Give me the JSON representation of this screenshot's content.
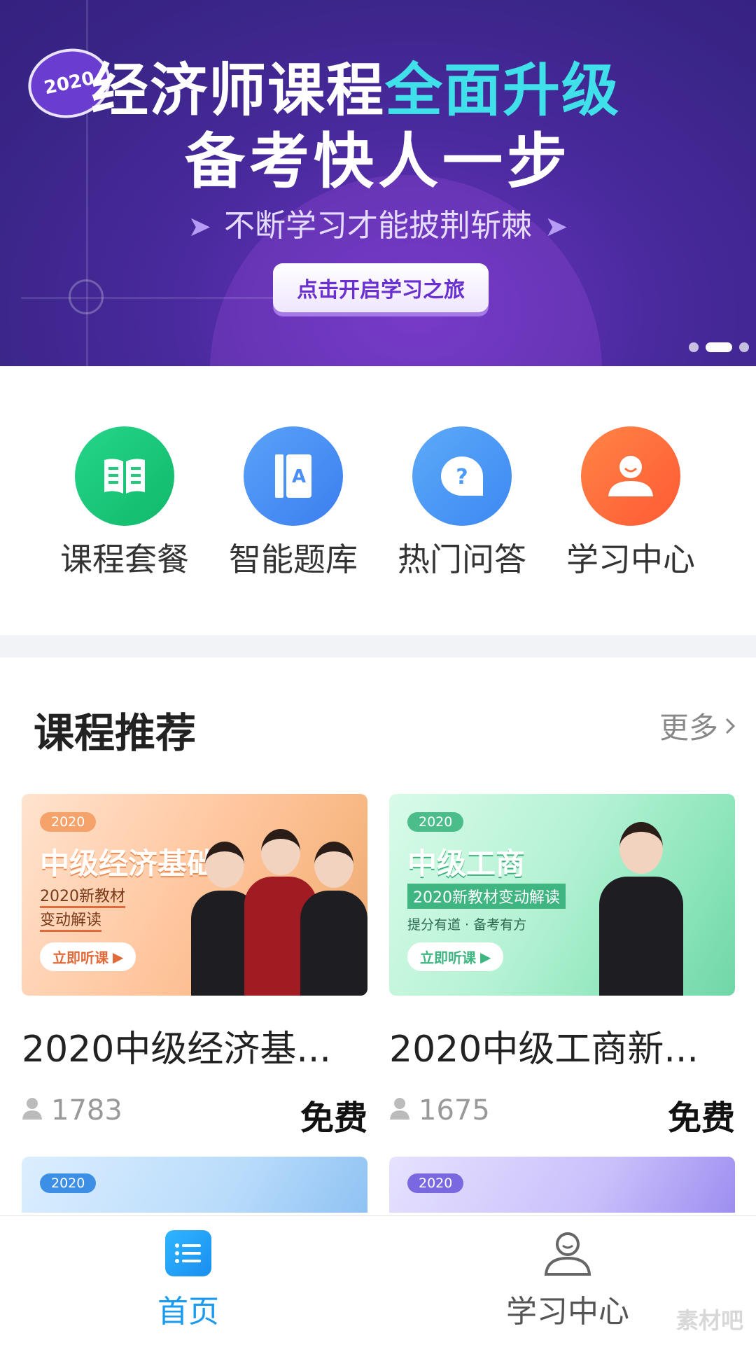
{
  "banner": {
    "year": "2020",
    "title_main": "经济师课程",
    "title_highlight": "全面升级",
    "subtitle": "备考快人一步",
    "slogan": "不断学习才能披荆斩棘",
    "cta": "点击开启学习之旅",
    "slides": 3,
    "active_slide": 2
  },
  "quick_menu": [
    {
      "label": "课程套餐",
      "icon": "book-icon",
      "color": "#1ecb7a"
    },
    {
      "label": "智能题库",
      "icon": "question-bank-icon",
      "color": "#4a8ff5"
    },
    {
      "label": "热门问答",
      "icon": "question-bubble-icon",
      "color": "#4b9af8"
    },
    {
      "label": "学习中心",
      "icon": "user-icon",
      "color": "#ff6f3c"
    }
  ],
  "section": {
    "title": "课程推荐",
    "more": "更多"
  },
  "courses": [
    {
      "title": "2020中级经济基...",
      "users": "1783",
      "price": "免费",
      "thumb": {
        "badge": "2020",
        "heading": "中级经济基础",
        "line1": "2020新教材",
        "line2": "变动解读",
        "button": "立即听课"
      }
    },
    {
      "title": "2020中级工商新...",
      "users": "1675",
      "price": "免费",
      "thumb": {
        "badge": "2020",
        "heading": "中级工商",
        "line1": "2020新教材变动解读",
        "line2": "提分有道 · 备考有方",
        "button": "立即听课"
      }
    }
  ],
  "partial_cards": [
    {
      "badge": "2020"
    },
    {
      "badge": "2020"
    }
  ],
  "tabbar": [
    {
      "label": "首页",
      "icon": "list-icon",
      "active": true
    },
    {
      "label": "学习中心",
      "icon": "person-icon",
      "active": false
    }
  ],
  "watermark": "素材吧",
  "colors": {
    "accent": "#1a9bf0",
    "banner_highlight": "#3fe0ea"
  }
}
